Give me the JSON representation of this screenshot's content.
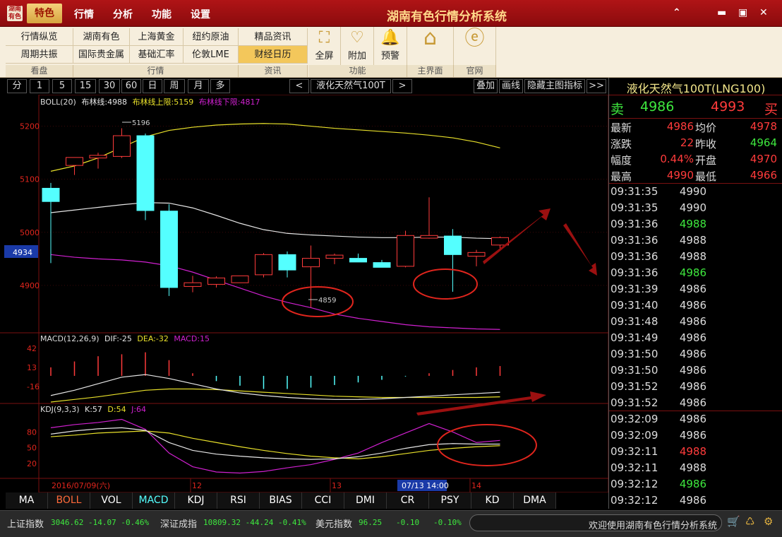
{
  "app": {
    "logo": "湖南有色",
    "title": "湖南有色行情分析系统"
  },
  "menu": [
    "特色",
    "行情",
    "分析",
    "功能",
    "设置"
  ],
  "window_buttons": [
    "⌃",
    "▬",
    "▣",
    "✕"
  ],
  "toolbar": {
    "row1": [
      "行情纵览",
      "湖南有色",
      "上海黄金",
      "纽约原油",
      "精品资讯"
    ],
    "row2": [
      "周期共振",
      "国际贵金属",
      "基础汇率",
      "伦敦LME",
      "财经日历"
    ],
    "big": [
      {
        "label": "全屏",
        "icon": "⛶"
      },
      {
        "label": "附加",
        "icon": "♡"
      },
      {
        "label": "预警",
        "icon": "🔔"
      },
      {
        "label": "主界面",
        "icon": "⌂"
      },
      {
        "label": "官网",
        "icon": "ⓔ"
      }
    ],
    "groups": [
      "看盘",
      "行情",
      "资讯",
      "功能",
      "主界面",
      "官网"
    ]
  },
  "periods": [
    "分",
    "1",
    "5",
    "15",
    "30",
    "60",
    "日",
    "周",
    "月",
    "多"
  ],
  "nav": {
    "prev": "<",
    "next": ">",
    "symbol": "液化天然气100T",
    "overlay": "叠加",
    "draw": "画线",
    "hide": "隐藏主图指标",
    "more": ">>"
  },
  "indicators": {
    "boll": {
      "name": "BOLL(20)",
      "mid_label": "布林线:4988",
      "up_label": "布林线上限:5159",
      "low_label": "布林线下限:4817"
    },
    "macd": {
      "name": "MACD(12,26,9)",
      "dif": "DIF:-25",
      "dea": "DEA:-32",
      "macd": "MACD:15"
    },
    "kdj": {
      "name": "KDJ(9,3,3)",
      "k": "K:57",
      "d": "D:54",
      "j": "J:64"
    }
  },
  "price_label": "4934",
  "annotations": {
    "high": "5196",
    "low": "4859"
  },
  "xaxis": {
    "first": "2016/07/09(六)",
    "labels": [
      "12",
      "13",
      "14"
    ],
    "highlight": "07/13 14:00"
  },
  "chart_data": {
    "type": "candlestick",
    "ylim": [
      4820,
      5230
    ],
    "yticks": [
      5200,
      5100,
      5000,
      4900
    ],
    "candles": [
      {
        "o": 5083,
        "h": 5093,
        "l": 4942,
        "c": 5058
      },
      {
        "o": 5126,
        "h": 5140,
        "l": 5108,
        "c": 5141
      },
      {
        "o": 5140,
        "h": 5150,
        "l": 5120,
        "c": 5145
      },
      {
        "o": 5143,
        "h": 5196,
        "l": 5140,
        "c": 5182
      },
      {
        "o": 5182,
        "h": 5186,
        "l": 5023,
        "c": 5041
      },
      {
        "o": 5040,
        "h": 5053,
        "l": 4880,
        "c": 4896
      },
      {
        "o": 4898,
        "h": 4918,
        "l": 4887,
        "c": 4905
      },
      {
        "o": 4902,
        "h": 4917,
        "l": 4896,
        "c": 4914
      },
      {
        "o": 4905,
        "h": 4918,
        "l": 4905,
        "c": 4918
      },
      {
        "o": 4920,
        "h": 4961,
        "l": 4915,
        "c": 4958
      },
      {
        "o": 4958,
        "h": 4964,
        "l": 4915,
        "c": 4929
      },
      {
        "o": 4935,
        "h": 4975,
        "l": 4859,
        "c": 4951
      },
      {
        "o": 4951,
        "h": 4960,
        "l": 4940,
        "c": 4957
      },
      {
        "o": 4951,
        "h": 4960,
        "l": 4946,
        "c": 4944
      },
      {
        "o": 4943,
        "h": 4948,
        "l": 4935,
        "c": 4934
      },
      {
        "o": 4936,
        "h": 5003,
        "l": 4934,
        "c": 4994
      },
      {
        "o": 4989,
        "h": 5066,
        "l": 4988,
        "c": 4994
      },
      {
        "o": 4993,
        "h": 5006,
        "l": 4888,
        "c": 4958
      },
      {
        "o": 4955,
        "h": 4967,
        "l": 4936,
        "c": 4962
      },
      {
        "o": 4976,
        "h": 4992,
        "l": 4966,
        "c": 4990
      }
    ],
    "boll_up": [
      5115,
      5125,
      5140,
      5160,
      5180,
      5192,
      5198,
      5202,
      5204,
      5205,
      5204,
      5200,
      5196,
      5193,
      5190,
      5187,
      5183,
      5178,
      5170,
      5159
    ],
    "boll_mid": [
      5037,
      5042,
      5047,
      5052,
      5056,
      5055,
      5046,
      5032,
      5017,
      5005,
      4998,
      4995,
      4993,
      4991,
      4990,
      4990,
      4991,
      4991,
      4989,
      4988
    ],
    "boll_low": [
      4958,
      4953,
      4950,
      4948,
      4944,
      4937,
      4925,
      4910,
      4895,
      4880,
      4868,
      4858,
      4846,
      4838,
      4832,
      4826,
      4822,
      4820,
      4818,
      4817
    ],
    "macd_ylim": [
      -40,
      55
    ],
    "macd_yticks": [
      42,
      13,
      -16
    ],
    "macd_bars": [
      13,
      22,
      30,
      33,
      36,
      24,
      4,
      -8,
      -15,
      -20,
      -20,
      -18,
      -14,
      -10,
      -6,
      -1,
      4,
      9,
      13,
      15
    ],
    "dif": [
      -30,
      -22,
      -12,
      -2,
      2,
      -4,
      -12,
      -20,
      -26,
      -30,
      -33,
      -35,
      -36,
      -36,
      -35,
      -33,
      -31,
      -29,
      -27,
      -25
    ],
    "dea": [
      -40,
      -36,
      -32,
      -27,
      -22,
      -20,
      -20,
      -21,
      -23,
      -25,
      -27,
      -29,
      -31,
      -32,
      -33,
      -33,
      -33,
      -33,
      -33,
      -32
    ],
    "kdj_ylim": [
      0,
      110
    ],
    "kdj_yticks": [
      80,
      50,
      20
    ],
    "k": [
      76,
      82,
      86,
      88,
      83,
      60,
      45,
      38,
      34,
      31,
      29,
      28,
      29,
      33,
      40,
      49,
      56,
      58,
      57,
      57
    ],
    "d": [
      71,
      74,
      78,
      80,
      82,
      78,
      68,
      60,
      52,
      45,
      39,
      34,
      31,
      29,
      33,
      39,
      45,
      49,
      52,
      54
    ],
    "j": [
      88,
      94,
      98,
      104,
      85,
      40,
      14,
      4,
      2,
      5,
      12,
      18,
      28,
      40,
      60,
      78,
      96,
      80,
      60,
      64
    ]
  },
  "quote": {
    "title": "液化天然气100T(LNG100)",
    "sell_label": "卖",
    "sell": "4986",
    "buy": "4993",
    "buy_label": "买",
    "rows": [
      {
        "l1": "最新",
        "v1": "4986",
        "c1": "#ff3b3b",
        "l2": "均价",
        "v2": "4978",
        "c2": "#ff3b3b"
      },
      {
        "l1": "涨跌",
        "v1": "22",
        "c1": "#ff3b3b",
        "l2": "昨收",
        "v2": "4964",
        "c2": "#3ee83e"
      },
      {
        "l1": "幅度",
        "v1": "0.44%",
        "c1": "#ff3b3b",
        "l2": "开盘",
        "v2": "4970",
        "c2": "#ff3b3b"
      },
      {
        "l1": "最高",
        "v1": "4990",
        "c1": "#ff3b3b",
        "l2": "最低",
        "v2": "4966",
        "c2": "#ff3b3b"
      }
    ],
    "ticks": [
      {
        "t": "09:31:35",
        "p": "4990",
        "c": "#dddddd"
      },
      {
        "t": "09:31:35",
        "p": "4990",
        "c": "#dddddd"
      },
      {
        "t": "09:31:36",
        "p": "4988",
        "c": "#3ee83e"
      },
      {
        "t": "09:31:36",
        "p": "4988",
        "c": "#dddddd"
      },
      {
        "t": "09:31:36",
        "p": "4988",
        "c": "#dddddd"
      },
      {
        "t": "09:31:36",
        "p": "4986",
        "c": "#3ee83e"
      },
      {
        "t": "09:31:39",
        "p": "4986",
        "c": "#dddddd"
      },
      {
        "t": "09:31:40",
        "p": "4986",
        "c": "#dddddd"
      },
      {
        "t": "09:31:48",
        "p": "4986",
        "c": "#dddddd"
      },
      {
        "t": "09:31:49",
        "p": "4986",
        "c": "#dddddd"
      },
      {
        "t": "09:31:50",
        "p": "4986",
        "c": "#dddddd"
      },
      {
        "t": "09:31:50",
        "p": "4986",
        "c": "#dddddd"
      },
      {
        "t": "09:31:52",
        "p": "4986",
        "c": "#dddddd"
      },
      {
        "t": "09:31:52",
        "p": "4986",
        "c": "#dddddd"
      },
      {
        "t": "09:32:09",
        "p": "4986",
        "c": "#dddddd"
      },
      {
        "t": "09:32:09",
        "p": "4986",
        "c": "#dddddd"
      },
      {
        "t": "09:32:11",
        "p": "4988",
        "c": "#ff3b3b"
      },
      {
        "t": "09:32:11",
        "p": "4988",
        "c": "#dddddd"
      },
      {
        "t": "09:32:12",
        "p": "4986",
        "c": "#3ee83e"
      },
      {
        "t": "09:32:12",
        "p": "4986",
        "c": "#dddddd"
      }
    ]
  },
  "tabs": [
    "MA",
    "BOLL",
    "VOL",
    "MACD",
    "KDJ",
    "RSI",
    "BIAS",
    "CCI",
    "DMI",
    "CR",
    "PSY",
    "KD",
    "DMA"
  ],
  "status": {
    "i1_name": "上证指数",
    "i1_val": "3046.62 -14.07 -0.46%",
    "i2_name": "深证成指",
    "i2_val": "10809.32 -44.24 -0.41%",
    "i3_name": "美元指数",
    "i3_val": "96.25   -0.10   -0.10%",
    "marquee": "欢迎使用湖南有色行情分析系统"
  },
  "colors": {
    "up": "#ff3b3b",
    "down": "#54ffff",
    "boll_up": "#e8e02a",
    "boll_mid": "#e6e6e6",
    "boll_low": "#d020d0",
    "dea": "#e8e02a",
    "dif": "#e6e6e6",
    "j": "#d020d0",
    "annot": "#e0251d"
  }
}
